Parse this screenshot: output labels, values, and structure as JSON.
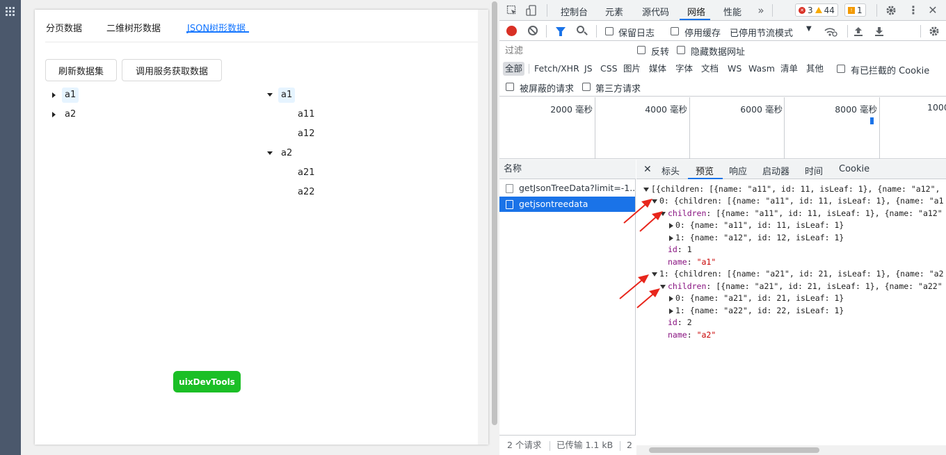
{
  "app": {
    "tabs": [
      {
        "label": "分页数据"
      },
      {
        "label": "二维树形数据"
      },
      {
        "label": "JSON树形数据"
      }
    ],
    "buttons": {
      "refresh": "刷新数据集",
      "fetch": "调用服务获取数据"
    },
    "tree_left": [
      "a1",
      "a2"
    ],
    "tree_right": {
      "nodes": [
        {
          "label": "a1",
          "children": [
            "a11",
            "a12"
          ]
        },
        {
          "label": "a2",
          "children": [
            "a21",
            "a22"
          ]
        }
      ]
    },
    "uix_button": "uixDevTools",
    "colors": {
      "accent": "#1677ff",
      "uix": "#1bbf26"
    }
  },
  "devtools": {
    "main_tabs": [
      "控制台",
      "元素",
      "源代码",
      "网络",
      "性能"
    ],
    "more_icon": "chevron-double-right-icon",
    "errors": "3",
    "warnings": "44",
    "issues": "1",
    "toolbar": {
      "preserve_log": "保留日志",
      "disable_cache": "停用缓存",
      "throttling": "已停用节流模式"
    },
    "filter_placeholder": "过滤",
    "invert": "反转",
    "hide_data_urls": "隐藏数据网址",
    "types": [
      "全部",
      "Fetch/XHR",
      "JS",
      "CSS",
      "图片",
      "媒体",
      "字体",
      "文档",
      "WS",
      "Wasm",
      "清单",
      "其他"
    ],
    "blocked_cookies": "有已拦截的 Cookie",
    "blocked_requests": "被屏蔽的请求",
    "third_party": "第三方请求",
    "timeline_labels": [
      "2000 毫秒",
      "4000 毫秒",
      "6000 毫秒",
      "8000 毫秒",
      "1000"
    ],
    "names_header": "名称",
    "requests": [
      "getJsonTreeData?limit=-1...",
      "getjsontreedata"
    ],
    "footer": {
      "count": "2 个请求",
      "transferred": "已传输 1.1 kB",
      "extra": "2"
    },
    "detail_tabs": [
      "标头",
      "预览",
      "响应",
      "启动器",
      "时间",
      "Cookie"
    ],
    "preview": {
      "l0": "[{children: [{name: \"a11\", id: 11, isLeaf: 1}, {name: \"a12\",",
      "l1": "0: {children: [{name: \"a11\", id: 11, isLeaf: 1}, {name: \"a1",
      "l2k": "children",
      "l2": ": [{name: \"a11\", id: 11, isLeaf: 1}, {name: \"a12\"",
      "l3": "0: {name: \"a11\", id: 11, isLeaf: 1}",
      "l4": "1: {name: \"a12\", id: 12, isLeaf: 1}",
      "l5k": "id",
      "l5": ": 1",
      "l6k": "name",
      "l6v": "\"a1\"",
      "l7": "1: {children: [{name: \"a21\", id: 21, isLeaf: 1}, {name: \"a2",
      "l8k": "children",
      "l8": ": [{name: \"a21\", id: 21, isLeaf: 1}, {name: \"a22\"",
      "l9": "0: {name: \"a21\", id: 21, isLeaf: 1}",
      "l10": "1: {name: \"a22\", id: 22, isLeaf: 1}",
      "l11k": "id",
      "l11": ": 2",
      "l12k": "name",
      "l12v": "\"a2\""
    }
  }
}
